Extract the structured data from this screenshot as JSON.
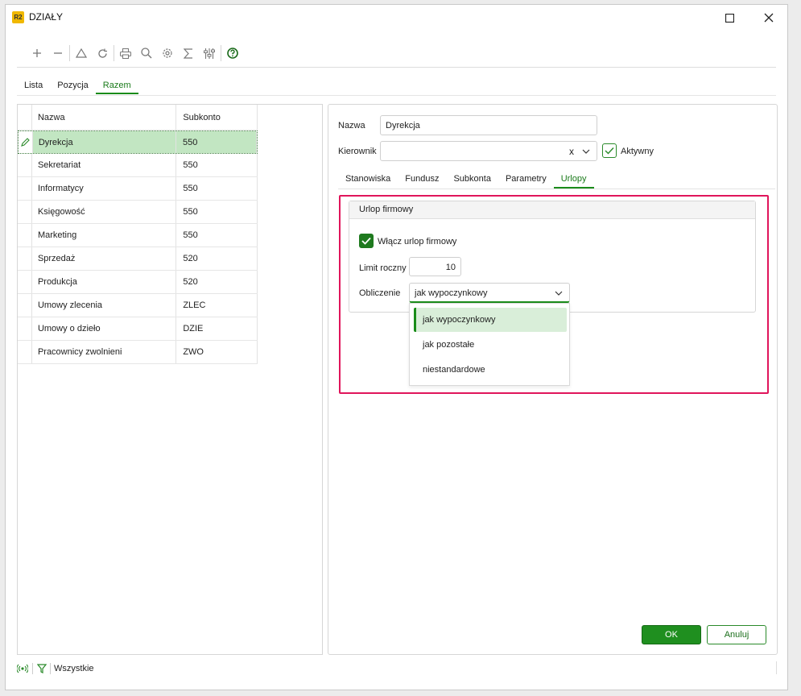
{
  "window": {
    "logo": "R2",
    "title": "DZIAŁY"
  },
  "toolbar": {
    "icons": [
      "plus-icon",
      "minus-icon",
      "triangle-icon",
      "refresh-icon",
      "print-icon",
      "search-icon",
      "gear-icon",
      "sigma-icon",
      "sliders-icon",
      "help-icon"
    ]
  },
  "top_tabs": [
    {
      "label": "Lista",
      "active": false
    },
    {
      "label": "Pozycja",
      "active": false
    },
    {
      "label": "Razem",
      "active": true
    }
  ],
  "grid": {
    "columns": [
      "Nazwa",
      "Subkonto"
    ],
    "rows": [
      {
        "nazwa": "Dyrekcja",
        "subkonto": "550",
        "selected": true
      },
      {
        "nazwa": "Sekretariat",
        "subkonto": "550"
      },
      {
        "nazwa": "Informatycy",
        "subkonto": "550"
      },
      {
        "nazwa": "Księgowość",
        "subkonto": "550"
      },
      {
        "nazwa": "Marketing",
        "subkonto": "550"
      },
      {
        "nazwa": "Sprzedaż",
        "subkonto": "520"
      },
      {
        "nazwa": "Produkcja",
        "subkonto": "520"
      },
      {
        "nazwa": "Umowy zlecenia",
        "subkonto": "ZLEC"
      },
      {
        "nazwa": "Umowy o dzieło",
        "subkonto": "DZIE"
      },
      {
        "nazwa": "Pracownicy zwolnieni",
        "subkonto": "ZWO"
      }
    ]
  },
  "form": {
    "nazwa_label": "Nazwa",
    "nazwa_value": "Dyrekcja",
    "kierownik_label": "Kierownik",
    "kierownik_value": "",
    "clear_glyph": "x",
    "aktywny_label": "Aktywny",
    "aktywny_checked": true
  },
  "sub_tabs": [
    {
      "label": "Stanowiska",
      "active": false
    },
    {
      "label": "Fundusz",
      "active": false
    },
    {
      "label": "Subkonta",
      "active": false
    },
    {
      "label": "Parametry",
      "active": false
    },
    {
      "label": "Urlopy",
      "active": true
    }
  ],
  "urlop": {
    "group_title": "Urlop firmowy",
    "enable_label": "Włącz urlop firmowy",
    "enable_checked": true,
    "limit_label": "Limit roczny",
    "limit_value": "10",
    "calc_label": "Obliczenie",
    "calc_value": "jak wypoczynkowy",
    "options": [
      "jak wypoczynkowy",
      "jak pozostałe",
      "niestandardowe"
    ],
    "selected_option": "jak wypoczynkowy"
  },
  "buttons": {
    "ok": "OK",
    "cancel": "Anuluj"
  },
  "status_bar": {
    "filter_label": "Wszystkie"
  },
  "colors": {
    "accent": "#1a8c1a",
    "selected_row": "#c2e6c2",
    "highlight_border": "#e0155b",
    "logo": "#f0b800"
  }
}
